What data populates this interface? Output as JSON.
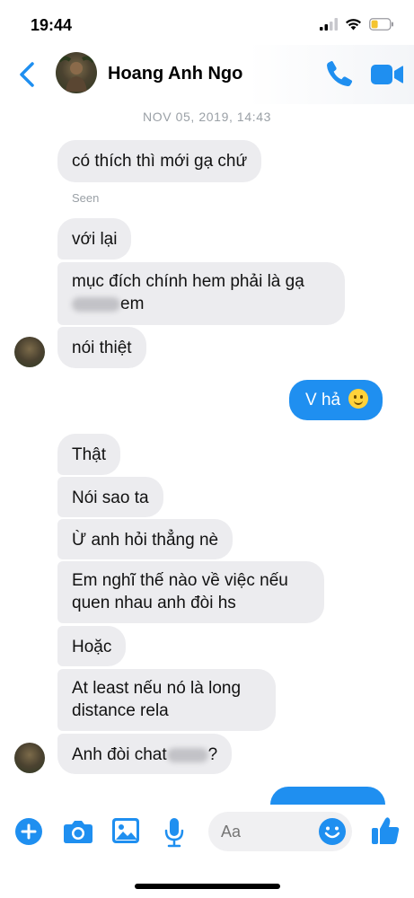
{
  "status_bar": {
    "time": "19:44"
  },
  "header": {
    "contact_name": "Hoang Anh Ngo"
  },
  "conversation": {
    "timestamp": "NOV 05, 2019, 14:43",
    "seen_label": "Seen",
    "messages": [
      {
        "side": "in",
        "text": "có thích thì  mới gạ chứ"
      },
      {
        "side": "in",
        "text": "với lại"
      },
      {
        "side": "in",
        "line1": "mục đích chính hem phải là gạ",
        "line2_suffix": "em"
      },
      {
        "side": "in",
        "text": "nói thiệt"
      },
      {
        "side": "out",
        "text": "V hả"
      },
      {
        "side": "in",
        "text": "Thật"
      },
      {
        "side": "in",
        "text": "Nói sao ta"
      },
      {
        "side": "in",
        "text": "Ừ anh hỏi thẳng nè"
      },
      {
        "side": "in",
        "line1": "Em nghĩ thế nào về việc nếu",
        "line2": "quen nhau anh đòi hs"
      },
      {
        "side": "in",
        "text": "Hoặc"
      },
      {
        "side": "in",
        "line1": "At least nếu nó là long",
        "line2": "distance rela"
      },
      {
        "side": "in",
        "prefix": "Anh đòi chat",
        "suffix": "?"
      }
    ]
  },
  "composer": {
    "placeholder": "Aa"
  },
  "colors": {
    "accent": "#1f8ff0",
    "incoming_bubble": "#ececef"
  },
  "icons": [
    "back-chevron-icon",
    "phone-icon",
    "video-camera-icon",
    "plus-icon",
    "camera-icon",
    "image-icon",
    "microphone-icon",
    "emoji-icon",
    "thumbs-up-icon"
  ]
}
